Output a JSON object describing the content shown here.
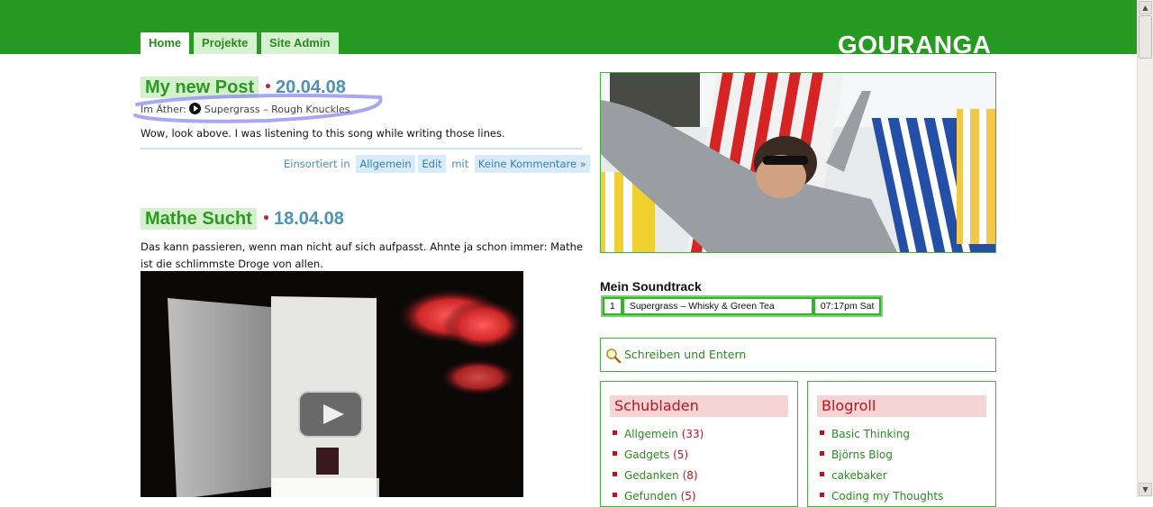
{
  "nav": {
    "tabs": [
      {
        "label": "Home",
        "active": true
      },
      {
        "label": "Projekte",
        "active": false
      },
      {
        "label": "Site Admin",
        "active": false
      }
    ],
    "site_title": "GOURANGA"
  },
  "posts": [
    {
      "title": "My new Post",
      "date": "20.04.08",
      "now_playing_label": "Im Äther:",
      "now_playing_track": "Supergrass – Rough Knuckles",
      "body": "Wow, look above. I was listening to this song while writing those lines.",
      "meta": {
        "filed_in_label": "Einsortiert in",
        "category": "Allgemein",
        "edit": "Edit",
        "with_label": "mit",
        "comments": "Keine Kommentare »"
      }
    },
    {
      "title": "Mathe Sucht",
      "date": "18.04.08",
      "body_line1": "Das kann passieren, wenn man nicht auf sich aufpasst. Ahnte ja schon immer: Mathe",
      "body_line2": "ist die schlimmste Droge von allen."
    }
  ],
  "sidebar": {
    "soundtrack": {
      "title": "Mein Soundtrack",
      "rows": [
        {
          "num": "1",
          "track": "Supergrass – Whisky & Green Tea",
          "time": "07:17pm Sat"
        }
      ]
    },
    "search": {
      "label": "Schreiben und Entern"
    },
    "categories": {
      "title": "Schubladen",
      "items": [
        {
          "label": "Allgemein",
          "count": "(33)"
        },
        {
          "label": "Gadgets",
          "count": "(5)"
        },
        {
          "label": "Gedanken",
          "count": "(8)"
        },
        {
          "label": "Gefunden",
          "count": "(5)"
        }
      ]
    },
    "blogroll": {
      "title": "Blogroll",
      "items": [
        {
          "label": "Basic Thinking"
        },
        {
          "label": "Björns Blog"
        },
        {
          "label": "cakebaker"
        },
        {
          "label": "Coding my Thoughts"
        }
      ]
    }
  },
  "colors": {
    "brand_green": "#279a22",
    "title_bg": "#d4f0cd",
    "date_blue": "#4b91b8",
    "accent_red": "#c0121e"
  }
}
